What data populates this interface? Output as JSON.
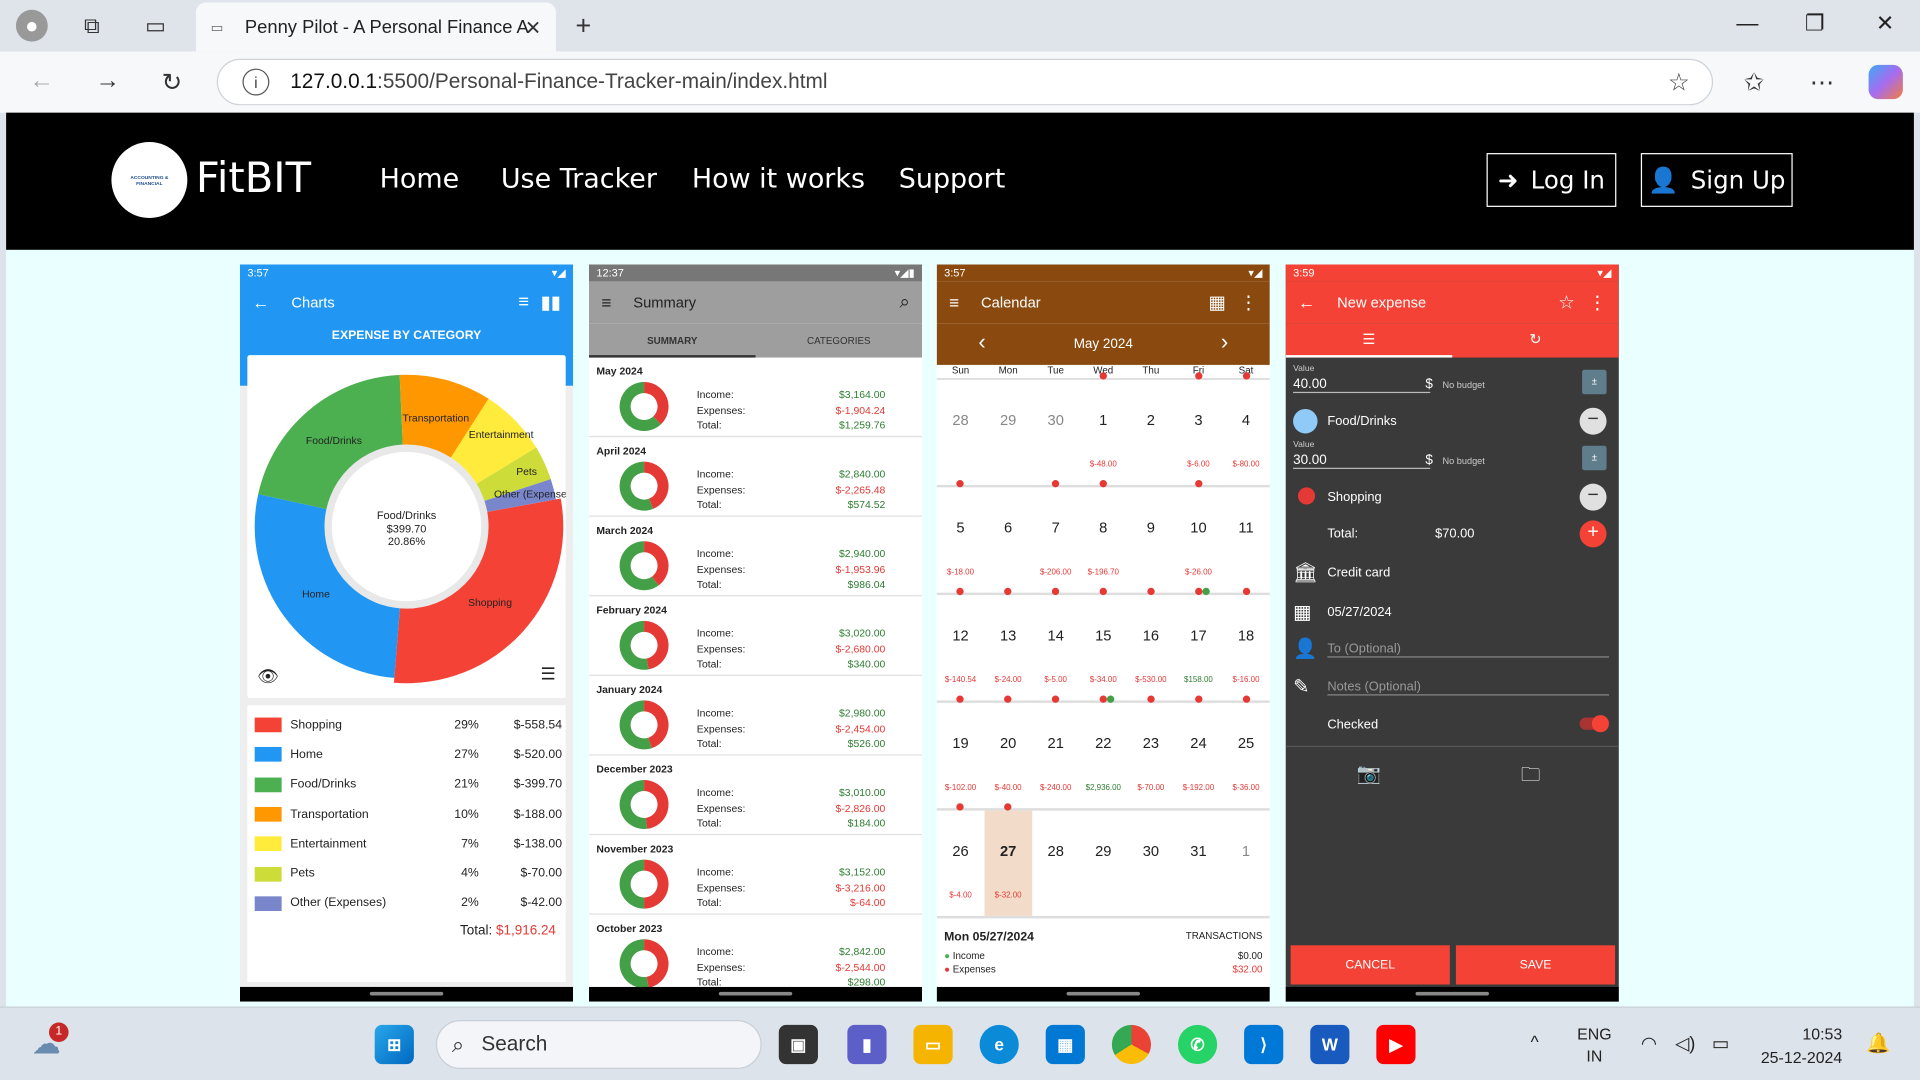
{
  "browser": {
    "tab_title": "Penny Pilot - A Personal Finance A",
    "url_host": "127.0.0.1",
    "url_path": ":5500/Personal-Finance-Tracker-main/index.html"
  },
  "site": {
    "logo_text": "ACCOUNTING & FINANCIAL",
    "brand": "FitBIT",
    "nav": [
      "Home",
      "Use Tracker",
      "How it works",
      "Support"
    ],
    "login": "Log In",
    "signup": "Sign Up"
  },
  "phone1": {
    "time": "3:57",
    "title": "Charts",
    "subtitle": "EXPENSE BY CATEGORY",
    "center_name": "Food/Drinks",
    "center_amount": "$399.70",
    "center_pct": "20.86%",
    "rows": [
      {
        "name": "Shopping",
        "pct": "29%",
        "amount": "$-558.54",
        "color": "#f44336"
      },
      {
        "name": "Home",
        "pct": "27%",
        "amount": "$-520.00",
        "color": "#2196f3"
      },
      {
        "name": "Food/Drinks",
        "pct": "21%",
        "amount": "$-399.70",
        "color": "#4caf50"
      },
      {
        "name": "Transportation",
        "pct": "10%",
        "amount": "$-188.00",
        "color": "#ff9800"
      },
      {
        "name": "Entertainment",
        "pct": "7%",
        "amount": "$-138.00",
        "color": "#ffeb3b"
      },
      {
        "name": "Pets",
        "pct": "4%",
        "amount": "$-70.00",
        "color": "#cddc39"
      },
      {
        "name": "Other (Expenses)",
        "pct": "2%",
        "amount": "$-42.00",
        "color": "#7986cb"
      }
    ],
    "total_label": "Total:",
    "total_value": "$1,916.24"
  },
  "phone2": {
    "time": "12:37",
    "title": "Summary",
    "tabs": [
      "SUMMARY",
      "CATEGORIES"
    ],
    "labels": [
      "Income:",
      "Expenses:",
      "Total:"
    ],
    "months": [
      {
        "name": "May 2024",
        "income": "$3,164.00",
        "expenses": "$-1,904.24",
        "total": "$1,259.76",
        "exp_share": 0.38
      },
      {
        "name": "April 2024",
        "income": "$2,840.00",
        "expenses": "$-2,265.48",
        "total": "$574.52",
        "exp_share": 0.44
      },
      {
        "name": "March 2024",
        "income": "$2,940.00",
        "expenses": "$-1,953.96",
        "total": "$986.04",
        "exp_share": 0.4
      },
      {
        "name": "February 2024",
        "income": "$3,020.00",
        "expenses": "$-2,680.00",
        "total": "$340.00",
        "exp_share": 0.47
      },
      {
        "name": "January 2024",
        "income": "$2,980.00",
        "expenses": "$-2,454.00",
        "total": "$526.00",
        "exp_share": 0.45
      },
      {
        "name": "December 2023",
        "income": "$3,010.00",
        "expenses": "$-2,826.00",
        "total": "$184.00",
        "exp_share": 0.48
      },
      {
        "name": "November 2023",
        "income": "$3,152.00",
        "expenses": "$-3,216.00",
        "total": "$-64.00",
        "exp_share": 0.5
      },
      {
        "name": "October 2023",
        "income": "$2,842.00",
        "expenses": "$-2,544.00",
        "total": "$298.00",
        "exp_share": 0.47
      }
    ]
  },
  "phone3": {
    "time": "3:57",
    "title": "Calendar",
    "month": "May 2024",
    "weekdays": [
      "Sun",
      "Mon",
      "Tue",
      "Wed",
      "Thu",
      "Fri",
      "Sat"
    ],
    "weeks": [
      [
        {
          "d": "28",
          "g": 1
        },
        {
          "d": "29",
          "g": 1
        },
        {
          "d": "30",
          "g": 1
        },
        {
          "d": "1",
          "e": "$-48.00",
          "dot": 1
        },
        {
          "d": "2"
        },
        {
          "d": "3",
          "e": "$-6.00",
          "dot": 1
        },
        {
          "d": "4",
          "e": "$-80.00",
          "dot": 1
        }
      ],
      [
        {
          "d": "5",
          "e": "$-18.00",
          "dot": 1
        },
        {
          "d": "6"
        },
        {
          "d": "7",
          "e": "$-206.00",
          "dot": 1
        },
        {
          "d": "8",
          "e": "$-196.70",
          "dot": 1
        },
        {
          "d": "9"
        },
        {
          "d": "10",
          "e": "$-26.00",
          "dot": 1
        },
        {
          "d": "11"
        }
      ],
      [
        {
          "d": "12",
          "e": "$-140.54",
          "dot": 1
        },
        {
          "d": "13",
          "e": "$-24.00",
          "dot": 1
        },
        {
          "d": "14",
          "e": "$-5.00",
          "dot": 1
        },
        {
          "d": "15",
          "e": "$-34.00",
          "dot": 1
        },
        {
          "d": "16",
          "e": "$-530.00",
          "dot": 1
        },
        {
          "d": "17",
          "e": "$158.00",
          "dot": 1,
          "green": 1
        },
        {
          "d": "18",
          "e": "$-16.00",
          "dot": 1
        }
      ],
      [
        {
          "d": "19",
          "e": "$-102.00",
          "dot": 1
        },
        {
          "d": "20",
          "e": "$-40.00",
          "dot": 1
        },
        {
          "d": "21",
          "e": "$-240.00",
          "dot": 1
        },
        {
          "d": "22",
          "e": "$2,936.00",
          "dot": 1,
          "green": 1
        },
        {
          "d": "23",
          "e": "$-70.00",
          "dot": 1
        },
        {
          "d": "24",
          "e": "$-192.00",
          "dot": 1
        },
        {
          "d": "25",
          "e": "$-36.00",
          "dot": 1
        }
      ],
      [
        {
          "d": "26",
          "e": "$-4.00",
          "dot": 1
        },
        {
          "d": "27",
          "e": "$-32.00",
          "dot": 1,
          "sel": 1
        },
        {
          "d": "28"
        },
        {
          "d": "29"
        },
        {
          "d": "30"
        },
        {
          "d": "31"
        },
        {
          "d": "1",
          "g": 1
        }
      ]
    ],
    "footer_date": "Mon 05/27/2024",
    "footer_right": "TRANSACTIONS",
    "footer_income_label": "Income",
    "footer_expenses_label": "Expenses",
    "footer_income": "$0.00",
    "footer_expenses": "$32.00"
  },
  "phone4": {
    "time": "3:59",
    "title": "New expense",
    "value_label": "Value",
    "value1": "40.00",
    "currency": "$",
    "budget": "No budget",
    "cat1": "Food/Drinks",
    "value2": "30.00",
    "cat2": "Shopping",
    "total_label": "Total:",
    "total_value": "$70.00",
    "account": "Credit card",
    "date": "05/27/2024",
    "to_placeholder": "To (Optional)",
    "notes_placeholder": "Notes (Optional)",
    "checked_label": "Checked",
    "cancel": "CANCEL",
    "save": "SAVE"
  },
  "taskbar": {
    "search": "Search",
    "lang1": "ENG",
    "lang2": "IN",
    "time": "10:53",
    "date": "25-12-2024",
    "weather_badge": "1"
  },
  "colors": {
    "accent_blue": "#2196f3",
    "accent_red": "#f44336",
    "calendar_brown": "#8a4a0f",
    "summary_gray": "#9e9e9e"
  }
}
